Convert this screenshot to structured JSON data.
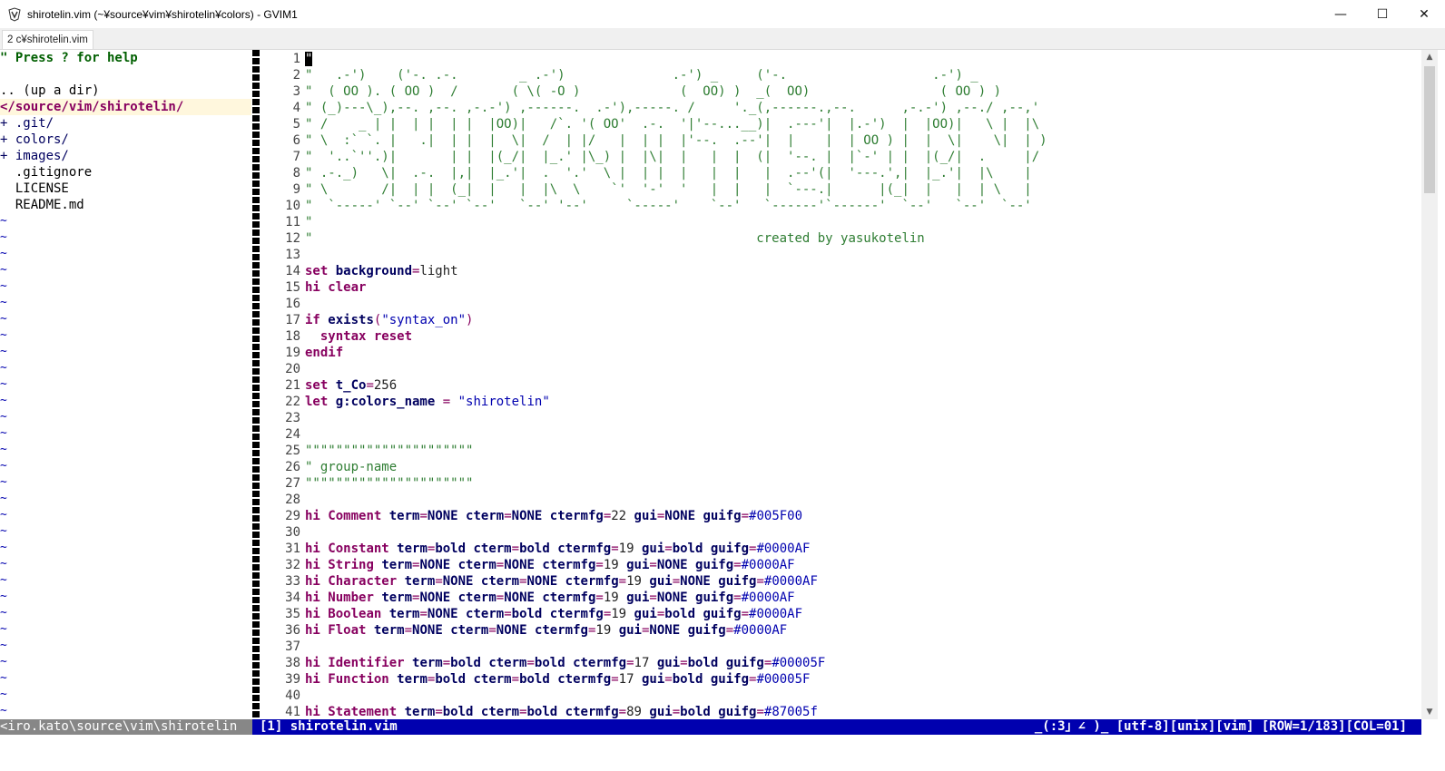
{
  "window": {
    "title": "shirotelin.vim (~¥source¥vim¥shirotelin¥colors) - GVIM1",
    "minimize": "—",
    "maximize": "☐",
    "close": "✕"
  },
  "tabs": [
    "2 c¥shirotelin.vim"
  ],
  "tree": {
    "help": "\" Press ? for help",
    "up": ".. (up a dir)",
    "root": "</source/vim/shirotelin/",
    "entries": [
      {
        "text": "+ .git/",
        "kind": "dir"
      },
      {
        "text": "+ colors/",
        "kind": "dir"
      },
      {
        "text": "+ images/",
        "kind": "dir"
      },
      {
        "text": "  .gitignore",
        "kind": "file"
      },
      {
        "text": "  LICENSE",
        "kind": "file"
      },
      {
        "text": "  README.md",
        "kind": "file"
      }
    ],
    "tilde": "~"
  },
  "editor": {
    "lines": [
      [
        [
          "g",
          "\""
        ]
      ],
      [
        [
          "g",
          "\"   .-')    ('-. .-.        _ .-')              .-') _     ('-.                   .-') _"
        ]
      ],
      [
        [
          "g",
          "\"  ( OO ). ( OO )  /       ( \\( -O )             (  OO) )  _(  OO)                 ( OO ) )"
        ]
      ],
      [
        [
          "g",
          "\" (_)---\\_),--. ,--. ,-.-') ,------.  .-'),-----. /     '._(,------.,--.      ,-.-') ,--./ ,--,'"
        ]
      ],
      [
        [
          "g",
          "\" /    _ | |  | |  | |  |OO)|   /`. '( OO'  .-.  '|'--...__)|  .---'|  |.-')  |  |OO)|   \\ |  |\\"
        ]
      ],
      [
        [
          "g",
          "\" \\  :` `. |   .|  | |  |  \\|  /  | |/   |  | |  |'--.  .--'|  |    |  | OO ) |  |  \\|    \\|  | )"
        ]
      ],
      [
        [
          "g",
          "\"  '..`''.)|       | |  |(_/|  |_.' |\\_) |  |\\|  |   |  |  (|  '--. |  |`-' | |  |(_/|  .     |/"
        ]
      ],
      [
        [
          "g",
          "\" .-._)   \\|  .-.  |,|  |_.'|  .  '.'  \\ |  | |  |   |  |   |  .--'(|  '---.',|  |_.'|  |\\    |"
        ]
      ],
      [
        [
          "g",
          "\" \\       /|  | |  (_|  |   |  |\\  \\    `'  '-'  '   |  |   |  `---.|      |(_|  |   |  | \\   |"
        ]
      ],
      [
        [
          "g",
          "\"  `-----' `--' `--' `--'   `--' '--'     `-----'    `--'   `------'`------'  `--'   `--'  `--'"
        ]
      ],
      [
        [
          "g",
          "\""
        ]
      ],
      [
        [
          "g",
          "\"                                                          created by yasukotelin"
        ]
      ],
      [],
      [
        [
          "kw",
          "set "
        ],
        [
          "nm",
          "background"
        ],
        [
          "op",
          "="
        ],
        [
          "tx",
          "light"
        ]
      ],
      [
        [
          "kw",
          "hi "
        ],
        [
          "kw",
          "clear"
        ]
      ],
      [],
      [
        [
          "kw",
          "if "
        ],
        [
          "fn",
          "exists"
        ],
        [
          "op",
          "("
        ],
        [
          "st",
          "\"syntax_on\""
        ],
        [
          "op",
          ")"
        ]
      ],
      [
        [
          "tx",
          "  "
        ],
        [
          "kw",
          "syntax reset"
        ]
      ],
      [
        [
          "kw",
          "endif"
        ]
      ],
      [],
      [
        [
          "kw",
          "set "
        ],
        [
          "nm",
          "t_Co"
        ],
        [
          "op",
          "="
        ],
        [
          "tx",
          "256"
        ]
      ],
      [
        [
          "kw",
          "let "
        ],
        [
          "nm",
          "g:colors_name"
        ],
        [
          "tx",
          " "
        ],
        [
          "op",
          "="
        ],
        [
          "tx",
          " "
        ],
        [
          "st",
          "\"shirotelin\""
        ]
      ],
      [],
      [],
      [
        [
          "g",
          "\"\"\"\"\"\"\"\"\"\"\"\"\"\"\"\"\"\"\"\"\"\""
        ]
      ],
      [
        [
          "g",
          "\" group-name"
        ]
      ],
      [
        [
          "g",
          "\"\"\"\"\"\"\"\"\"\"\"\"\"\"\"\"\"\"\"\"\"\""
        ]
      ],
      [],
      [
        [
          "kw",
          "hi "
        ],
        [
          "kw",
          "Comment "
        ],
        [
          "nm",
          "term"
        ],
        [
          "op",
          "="
        ],
        [
          "nm",
          "NONE "
        ],
        [
          "nm",
          "cterm"
        ],
        [
          "op",
          "="
        ],
        [
          "nm",
          "NONE "
        ],
        [
          "nm",
          "ctermfg"
        ],
        [
          "op",
          "="
        ],
        [
          "tx",
          "22 "
        ],
        [
          "nm",
          "gui"
        ],
        [
          "op",
          "="
        ],
        [
          "nm",
          "NONE "
        ],
        [
          "nm",
          "guifg"
        ],
        [
          "op",
          "="
        ],
        [
          "st",
          "#005F00"
        ]
      ],
      [],
      [
        [
          "kw",
          "hi "
        ],
        [
          "kw",
          "Constant "
        ],
        [
          "nm",
          "term"
        ],
        [
          "op",
          "="
        ],
        [
          "nm",
          "bold "
        ],
        [
          "nm",
          "cterm"
        ],
        [
          "op",
          "="
        ],
        [
          "nm",
          "bold "
        ],
        [
          "nm",
          "ctermfg"
        ],
        [
          "op",
          "="
        ],
        [
          "tx",
          "19 "
        ],
        [
          "nm",
          "gui"
        ],
        [
          "op",
          "="
        ],
        [
          "nm",
          "bold "
        ],
        [
          "nm",
          "guifg"
        ],
        [
          "op",
          "="
        ],
        [
          "st",
          "#0000AF"
        ]
      ],
      [
        [
          "kw",
          "hi "
        ],
        [
          "kw",
          "String "
        ],
        [
          "nm",
          "term"
        ],
        [
          "op",
          "="
        ],
        [
          "nm",
          "NONE "
        ],
        [
          "nm",
          "cterm"
        ],
        [
          "op",
          "="
        ],
        [
          "nm",
          "NONE "
        ],
        [
          "nm",
          "ctermfg"
        ],
        [
          "op",
          "="
        ],
        [
          "tx",
          "19 "
        ],
        [
          "nm",
          "gui"
        ],
        [
          "op",
          "="
        ],
        [
          "nm",
          "NONE "
        ],
        [
          "nm",
          "guifg"
        ],
        [
          "op",
          "="
        ],
        [
          "st",
          "#0000AF"
        ]
      ],
      [
        [
          "kw",
          "hi "
        ],
        [
          "kw",
          "Character "
        ],
        [
          "nm",
          "term"
        ],
        [
          "op",
          "="
        ],
        [
          "nm",
          "NONE "
        ],
        [
          "nm",
          "cterm"
        ],
        [
          "op",
          "="
        ],
        [
          "nm",
          "NONE "
        ],
        [
          "nm",
          "ctermfg"
        ],
        [
          "op",
          "="
        ],
        [
          "tx",
          "19 "
        ],
        [
          "nm",
          "gui"
        ],
        [
          "op",
          "="
        ],
        [
          "nm",
          "NONE "
        ],
        [
          "nm",
          "guifg"
        ],
        [
          "op",
          "="
        ],
        [
          "st",
          "#0000AF"
        ]
      ],
      [
        [
          "kw",
          "hi "
        ],
        [
          "kw",
          "Number "
        ],
        [
          "nm",
          "term"
        ],
        [
          "op",
          "="
        ],
        [
          "nm",
          "NONE "
        ],
        [
          "nm",
          "cterm"
        ],
        [
          "op",
          "="
        ],
        [
          "nm",
          "NONE "
        ],
        [
          "nm",
          "ctermfg"
        ],
        [
          "op",
          "="
        ],
        [
          "tx",
          "19 "
        ],
        [
          "nm",
          "gui"
        ],
        [
          "op",
          "="
        ],
        [
          "nm",
          "NONE "
        ],
        [
          "nm",
          "guifg"
        ],
        [
          "op",
          "="
        ],
        [
          "st",
          "#0000AF"
        ]
      ],
      [
        [
          "kw",
          "hi "
        ],
        [
          "kw",
          "Boolean "
        ],
        [
          "nm",
          "term"
        ],
        [
          "op",
          "="
        ],
        [
          "nm",
          "NONE "
        ],
        [
          "nm",
          "cterm"
        ],
        [
          "op",
          "="
        ],
        [
          "nm",
          "bold "
        ],
        [
          "nm",
          "ctermfg"
        ],
        [
          "op",
          "="
        ],
        [
          "tx",
          "19 "
        ],
        [
          "nm",
          "gui"
        ],
        [
          "op",
          "="
        ],
        [
          "nm",
          "bold "
        ],
        [
          "nm",
          "guifg"
        ],
        [
          "op",
          "="
        ],
        [
          "st",
          "#0000AF"
        ]
      ],
      [
        [
          "kw",
          "hi "
        ],
        [
          "kw",
          "Float "
        ],
        [
          "nm",
          "term"
        ],
        [
          "op",
          "="
        ],
        [
          "nm",
          "NONE "
        ],
        [
          "nm",
          "cterm"
        ],
        [
          "op",
          "="
        ],
        [
          "nm",
          "NONE "
        ],
        [
          "nm",
          "ctermfg"
        ],
        [
          "op",
          "="
        ],
        [
          "tx",
          "19 "
        ],
        [
          "nm",
          "gui"
        ],
        [
          "op",
          "="
        ],
        [
          "nm",
          "NONE "
        ],
        [
          "nm",
          "guifg"
        ],
        [
          "op",
          "="
        ],
        [
          "st",
          "#0000AF"
        ]
      ],
      [],
      [
        [
          "kw",
          "hi "
        ],
        [
          "kw",
          "Identifier "
        ],
        [
          "nm",
          "term"
        ],
        [
          "op",
          "="
        ],
        [
          "nm",
          "bold "
        ],
        [
          "nm",
          "cterm"
        ],
        [
          "op",
          "="
        ],
        [
          "nm",
          "bold "
        ],
        [
          "nm",
          "ctermfg"
        ],
        [
          "op",
          "="
        ],
        [
          "tx",
          "17 "
        ],
        [
          "nm",
          "gui"
        ],
        [
          "op",
          "="
        ],
        [
          "nm",
          "bold "
        ],
        [
          "nm",
          "guifg"
        ],
        [
          "op",
          "="
        ],
        [
          "st",
          "#00005F"
        ]
      ],
      [
        [
          "kw",
          "hi "
        ],
        [
          "kw",
          "Function "
        ],
        [
          "nm",
          "term"
        ],
        [
          "op",
          "="
        ],
        [
          "nm",
          "bold "
        ],
        [
          "nm",
          "cterm"
        ],
        [
          "op",
          "="
        ],
        [
          "nm",
          "bold "
        ],
        [
          "nm",
          "ctermfg"
        ],
        [
          "op",
          "="
        ],
        [
          "tx",
          "17 "
        ],
        [
          "nm",
          "gui"
        ],
        [
          "op",
          "="
        ],
        [
          "nm",
          "bold "
        ],
        [
          "nm",
          "guifg"
        ],
        [
          "op",
          "="
        ],
        [
          "st",
          "#00005F"
        ]
      ],
      [],
      [
        [
          "kw",
          "hi "
        ],
        [
          "kw",
          "Statement "
        ],
        [
          "nm",
          "term"
        ],
        [
          "op",
          "="
        ],
        [
          "nm",
          "bold "
        ],
        [
          "nm",
          "cterm"
        ],
        [
          "op",
          "="
        ],
        [
          "nm",
          "bold "
        ],
        [
          "nm",
          "ctermfg"
        ],
        [
          "op",
          "="
        ],
        [
          "tx",
          "89 "
        ],
        [
          "nm",
          "gui"
        ],
        [
          "op",
          "="
        ],
        [
          "nm",
          "bold "
        ],
        [
          "nm",
          "guifg"
        ],
        [
          "op",
          "="
        ],
        [
          "st",
          "#87005f"
        ]
      ]
    ]
  },
  "status": {
    "path": "<iro.kato\\source\\vim\\shirotelin",
    "file": "[1] shirotelin.vim",
    "right": "_(:3」∠ )_ [utf-8][unix][vim] [ROW=1/183][COL=01]"
  },
  "colors": {
    "statusline_bg": "#0000af",
    "statusline_inactive_bg": "#878787",
    "comment_green": "#2e7d32",
    "keyword": "#87005f",
    "name": "#00005f",
    "string": "#0000af",
    "tilde": "#0000af"
  }
}
